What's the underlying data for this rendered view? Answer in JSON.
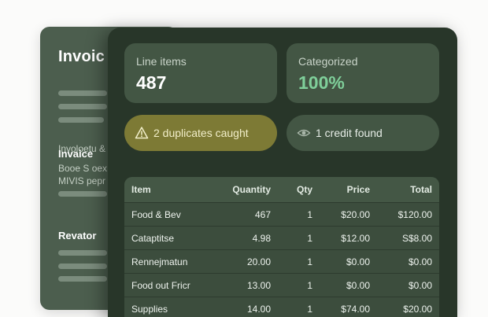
{
  "back_document": {
    "title": "Invoic",
    "subtitle": "Involoetu &",
    "section1_heading": "Invaice",
    "section1_line1": "Booe S oex",
    "section1_line2": "MIVIS pepr",
    "section2_heading": "Revator"
  },
  "stats": {
    "line_items": {
      "label": "Line items",
      "value": "487"
    },
    "categorized": {
      "label": "Categorized",
      "value": "100%"
    }
  },
  "alerts": {
    "duplicates": {
      "icon": "warning-triangle-icon",
      "text": "2 duplicates caught"
    },
    "credit": {
      "icon": "eye-icon",
      "text": "1 credit found"
    }
  },
  "table": {
    "headers": {
      "item": "Item",
      "quantity": "Quantity",
      "qty": "Qty",
      "price": "Price",
      "total": "Total"
    },
    "rows": [
      {
        "item": "Food & Bev",
        "quantity": "467",
        "qty": "1",
        "price": "$20.00",
        "total": "$120.00"
      },
      {
        "item": "Cataptitse",
        "quantity": "4.98",
        "qty": "1",
        "price": "$12.00",
        "total": "S$8.00"
      },
      {
        "item": "Rennejmatun",
        "quantity": "20.00",
        "qty": "1",
        "price": "$0.00",
        "total": "$0.00"
      },
      {
        "item": "Food out Fricr",
        "quantity": "13.00",
        "qty": "1",
        "price": "$0.00",
        "total": "$0.00"
      },
      {
        "item": "Supplies",
        "quantity": "14.00",
        "qty": "1",
        "price": "$74.00",
        "total": "$20.00"
      }
    ]
  },
  "colors": {
    "accent_green": "#7fcf9a",
    "warning_pill": "#7d7a35",
    "warning_text": "#f1eec9",
    "panel": "#283629",
    "card": "#435644"
  }
}
